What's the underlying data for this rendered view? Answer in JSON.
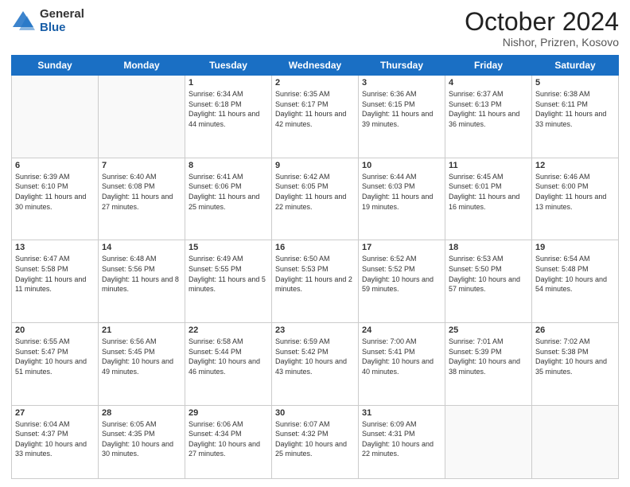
{
  "logo": {
    "general": "General",
    "blue": "Blue"
  },
  "title": {
    "month": "October 2024",
    "location": "Nishor, Prizren, Kosovo"
  },
  "weekdays": [
    "Sunday",
    "Monday",
    "Tuesday",
    "Wednesday",
    "Thursday",
    "Friday",
    "Saturday"
  ],
  "weeks": [
    [
      {
        "day": "",
        "info": ""
      },
      {
        "day": "",
        "info": ""
      },
      {
        "day": "1",
        "info": "Sunrise: 6:34 AM\nSunset: 6:18 PM\nDaylight: 11 hours and 44 minutes."
      },
      {
        "day": "2",
        "info": "Sunrise: 6:35 AM\nSunset: 6:17 PM\nDaylight: 11 hours and 42 minutes."
      },
      {
        "day": "3",
        "info": "Sunrise: 6:36 AM\nSunset: 6:15 PM\nDaylight: 11 hours and 39 minutes."
      },
      {
        "day": "4",
        "info": "Sunrise: 6:37 AM\nSunset: 6:13 PM\nDaylight: 11 hours and 36 minutes."
      },
      {
        "day": "5",
        "info": "Sunrise: 6:38 AM\nSunset: 6:11 PM\nDaylight: 11 hours and 33 minutes."
      }
    ],
    [
      {
        "day": "6",
        "info": "Sunrise: 6:39 AM\nSunset: 6:10 PM\nDaylight: 11 hours and 30 minutes."
      },
      {
        "day": "7",
        "info": "Sunrise: 6:40 AM\nSunset: 6:08 PM\nDaylight: 11 hours and 27 minutes."
      },
      {
        "day": "8",
        "info": "Sunrise: 6:41 AM\nSunset: 6:06 PM\nDaylight: 11 hours and 25 minutes."
      },
      {
        "day": "9",
        "info": "Sunrise: 6:42 AM\nSunset: 6:05 PM\nDaylight: 11 hours and 22 minutes."
      },
      {
        "day": "10",
        "info": "Sunrise: 6:44 AM\nSunset: 6:03 PM\nDaylight: 11 hours and 19 minutes."
      },
      {
        "day": "11",
        "info": "Sunrise: 6:45 AM\nSunset: 6:01 PM\nDaylight: 11 hours and 16 minutes."
      },
      {
        "day": "12",
        "info": "Sunrise: 6:46 AM\nSunset: 6:00 PM\nDaylight: 11 hours and 13 minutes."
      }
    ],
    [
      {
        "day": "13",
        "info": "Sunrise: 6:47 AM\nSunset: 5:58 PM\nDaylight: 11 hours and 11 minutes."
      },
      {
        "day": "14",
        "info": "Sunrise: 6:48 AM\nSunset: 5:56 PM\nDaylight: 11 hours and 8 minutes."
      },
      {
        "day": "15",
        "info": "Sunrise: 6:49 AM\nSunset: 5:55 PM\nDaylight: 11 hours and 5 minutes."
      },
      {
        "day": "16",
        "info": "Sunrise: 6:50 AM\nSunset: 5:53 PM\nDaylight: 11 hours and 2 minutes."
      },
      {
        "day": "17",
        "info": "Sunrise: 6:52 AM\nSunset: 5:52 PM\nDaylight: 10 hours and 59 minutes."
      },
      {
        "day": "18",
        "info": "Sunrise: 6:53 AM\nSunset: 5:50 PM\nDaylight: 10 hours and 57 minutes."
      },
      {
        "day": "19",
        "info": "Sunrise: 6:54 AM\nSunset: 5:48 PM\nDaylight: 10 hours and 54 minutes."
      }
    ],
    [
      {
        "day": "20",
        "info": "Sunrise: 6:55 AM\nSunset: 5:47 PM\nDaylight: 10 hours and 51 minutes."
      },
      {
        "day": "21",
        "info": "Sunrise: 6:56 AM\nSunset: 5:45 PM\nDaylight: 10 hours and 49 minutes."
      },
      {
        "day": "22",
        "info": "Sunrise: 6:58 AM\nSunset: 5:44 PM\nDaylight: 10 hours and 46 minutes."
      },
      {
        "day": "23",
        "info": "Sunrise: 6:59 AM\nSunset: 5:42 PM\nDaylight: 10 hours and 43 minutes."
      },
      {
        "day": "24",
        "info": "Sunrise: 7:00 AM\nSunset: 5:41 PM\nDaylight: 10 hours and 40 minutes."
      },
      {
        "day": "25",
        "info": "Sunrise: 7:01 AM\nSunset: 5:39 PM\nDaylight: 10 hours and 38 minutes."
      },
      {
        "day": "26",
        "info": "Sunrise: 7:02 AM\nSunset: 5:38 PM\nDaylight: 10 hours and 35 minutes."
      }
    ],
    [
      {
        "day": "27",
        "info": "Sunrise: 6:04 AM\nSunset: 4:37 PM\nDaylight: 10 hours and 33 minutes."
      },
      {
        "day": "28",
        "info": "Sunrise: 6:05 AM\nSunset: 4:35 PM\nDaylight: 10 hours and 30 minutes."
      },
      {
        "day": "29",
        "info": "Sunrise: 6:06 AM\nSunset: 4:34 PM\nDaylight: 10 hours and 27 minutes."
      },
      {
        "day": "30",
        "info": "Sunrise: 6:07 AM\nSunset: 4:32 PM\nDaylight: 10 hours and 25 minutes."
      },
      {
        "day": "31",
        "info": "Sunrise: 6:09 AM\nSunset: 4:31 PM\nDaylight: 10 hours and 22 minutes."
      },
      {
        "day": "",
        "info": ""
      },
      {
        "day": "",
        "info": ""
      }
    ]
  ]
}
